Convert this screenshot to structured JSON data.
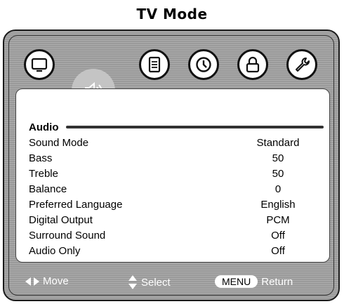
{
  "page_title": "TV Mode",
  "tabs": [
    {
      "icon": "monitor-icon"
    },
    {
      "icon": "speaker-icon",
      "active": true
    },
    {
      "icon": "document-icon"
    },
    {
      "icon": "clock-icon"
    },
    {
      "icon": "lock-icon"
    },
    {
      "icon": "wrench-icon"
    }
  ],
  "section_title": "Audio",
  "menu_items": [
    {
      "label": "Sound Mode",
      "value": "Standard"
    },
    {
      "label": "Bass",
      "value": "50"
    },
    {
      "label": "Treble",
      "value": "50"
    },
    {
      "label": "Balance",
      "value": "0"
    },
    {
      "label": "Preferred Language",
      "value": "English"
    },
    {
      "label": "Digital Output",
      "value": "PCM"
    },
    {
      "label": "Surround Sound",
      "value": "Off"
    },
    {
      "label": "Audio Only",
      "value": "Off"
    }
  ],
  "footer": {
    "move_label": "Move",
    "select_label": "Select",
    "menu_key": "MENU",
    "return_label": "Return"
  }
}
